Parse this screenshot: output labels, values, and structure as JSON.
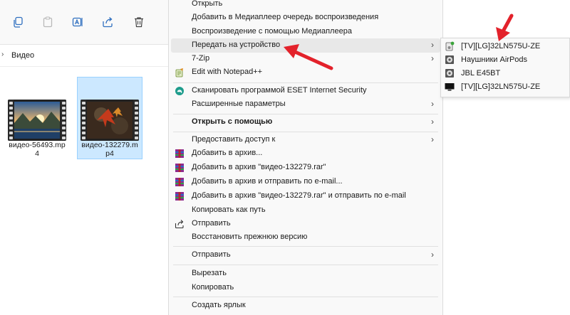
{
  "explorer": {
    "toolbar_icons": [
      "copy-icon",
      "paste-icon",
      "rename-icon",
      "share-icon",
      "delete-icon"
    ],
    "address": {
      "current_folder": "Видео"
    },
    "files": [
      {
        "name": "видео-56493.mp4",
        "selected": false
      },
      {
        "name": "видео-132279.mp4",
        "selected": true
      }
    ]
  },
  "context_menu": {
    "items": [
      {
        "label": "Открыть",
        "submenu": false
      },
      {
        "label": "Добавить в Медиаплеер очередь воспроизведения",
        "submenu": false
      },
      {
        "label": "Воспроизведение с помощью Медиаплеера",
        "submenu": false
      },
      {
        "label": "Передать на устройство",
        "submenu": true,
        "highlighted": true
      },
      {
        "label": "7-Zip",
        "submenu": true
      },
      {
        "label": "Edit with Notepad++",
        "submenu": false,
        "icon": "notepadpp-icon"
      },
      {
        "label": "Сканировать программой ESET Internet Security",
        "submenu": false,
        "icon": "eset-icon"
      },
      {
        "label": "Расширенные параметры",
        "submenu": true
      },
      {
        "label": "Открыть с помощью",
        "submenu": true,
        "bold": true
      },
      {
        "label": "Предоставить доступ к",
        "submenu": true
      },
      {
        "label": "Добавить в архив...",
        "submenu": false,
        "icon": "winrar-icon"
      },
      {
        "label": "Добавить в архив \"видео-132279.rar\"",
        "submenu": false,
        "icon": "winrar-icon"
      },
      {
        "label": "Добавить в архив и отправить по e-mail...",
        "submenu": false,
        "icon": "winrar-icon"
      },
      {
        "label": "Добавить в архив \"видео-132279.rar\" и отправить по e-mail",
        "submenu": false,
        "icon": "winrar-icon"
      },
      {
        "label": "Копировать как путь",
        "submenu": false
      },
      {
        "label": "Отправить",
        "submenu": false,
        "icon": "share-icon"
      },
      {
        "label": "Восстановить прежнюю версию",
        "submenu": false
      },
      {
        "label": "Отправить",
        "submenu": true
      },
      {
        "label": "Вырезать",
        "submenu": false
      },
      {
        "label": "Копировать",
        "submenu": false
      },
      {
        "label": "Создать ярлык",
        "submenu": false
      }
    ]
  },
  "cast_submenu": {
    "items": [
      {
        "label": "[TV][LG]32LN575U-ZE",
        "icon": "media-server-icon"
      },
      {
        "label": "Наушники AirPods",
        "icon": "speaker-icon"
      },
      {
        "label": "JBL E45BT",
        "icon": "speaker-icon"
      },
      {
        "label": "[TV][LG]32LN575U-ZE",
        "icon": "tv-icon"
      }
    ]
  },
  "colors": {
    "menu_bg": "#f9f9f9",
    "highlight": "#e8e8e8",
    "selection": "#cce8ff",
    "annotation_arrow": "#e3222b",
    "winrar": "#b4282d"
  }
}
